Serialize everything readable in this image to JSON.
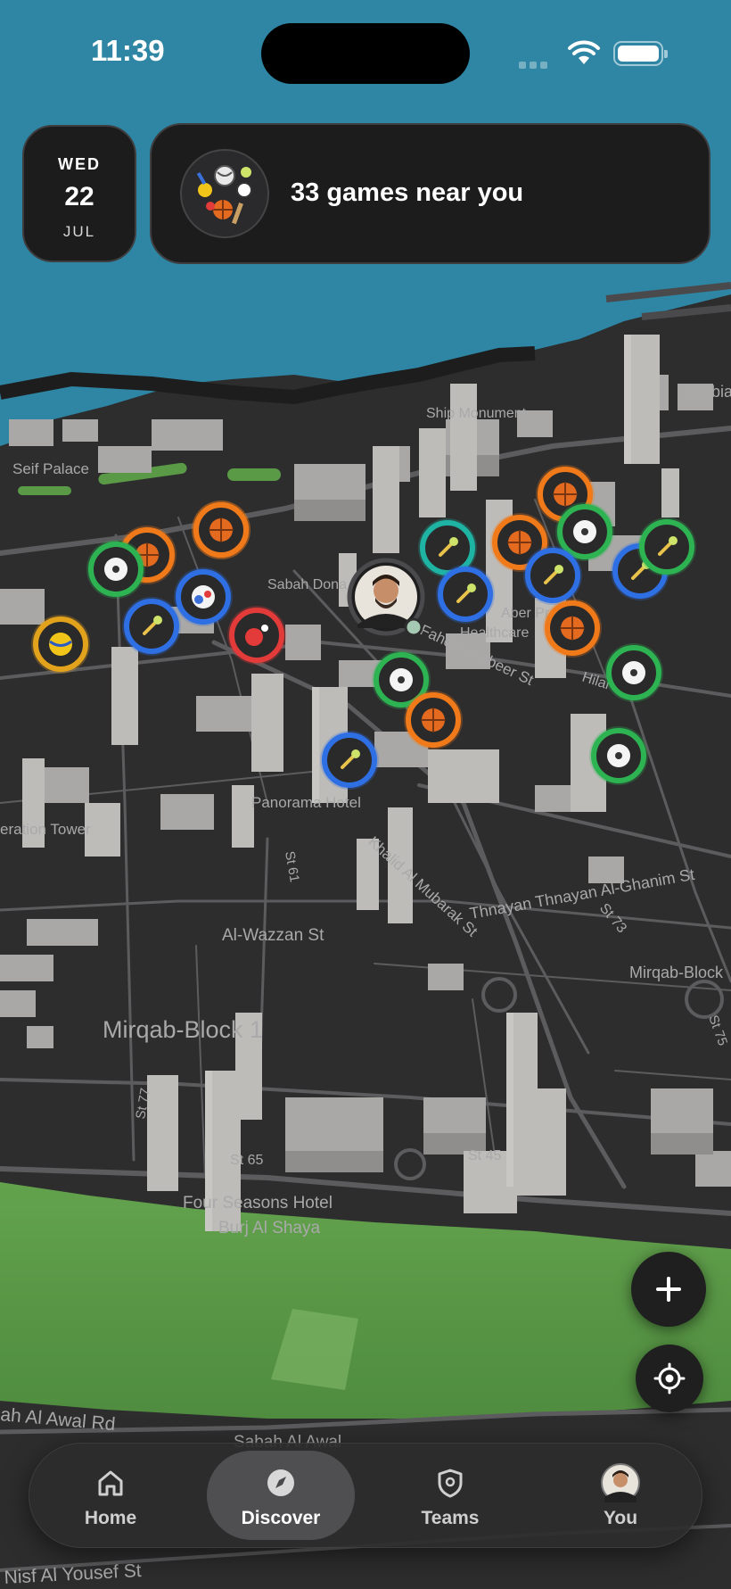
{
  "status_bar": {
    "time": "11:39"
  },
  "date_card": {
    "weekday": "WED",
    "day": "22",
    "month": "JUL"
  },
  "games_card": {
    "title": "33 games near you",
    "icon": "sports-collage-icon"
  },
  "map": {
    "labels": [
      {
        "text": "Seif Palace"
      },
      {
        "text": "Ship Monument"
      },
      {
        "text": "Arabia"
      },
      {
        "text": "Sabah Dona"
      },
      {
        "text": "Aber Pr"
      },
      {
        "text": "Healthcare"
      },
      {
        "text": "Fahd Al Kabeer St"
      },
      {
        "text": "Hilal St"
      },
      {
        "text": "Panorama Hotel"
      },
      {
        "text": "eration Tower"
      },
      {
        "text": "Al-Wazzan St"
      },
      {
        "text": "St 61"
      },
      {
        "text": "Khalid Al Mubarak St"
      },
      {
        "text": "Thnayan Thnayan Al-Ghanim St"
      },
      {
        "text": "St 73"
      },
      {
        "text": "Mirqab-Block"
      },
      {
        "text": "Mirqab-Block 1"
      },
      {
        "text": "St 77"
      },
      {
        "text": "St 65"
      },
      {
        "text": "St 45"
      },
      {
        "text": "Four Seasons Hotel"
      },
      {
        "text": "Burj Al Shaya"
      },
      {
        "text": "ah Al Awal Rd"
      },
      {
        "text": "Sabah Al Awal"
      },
      {
        "text": "Nisf Al Yousef St"
      },
      {
        "text": "St 75"
      }
    ],
    "pins": [
      {
        "sport": "basketball",
        "ring": "#f07a1a"
      },
      {
        "sport": "volleyball",
        "ring": "#e3a21c"
      },
      {
        "sport": "soccer",
        "ring": "#2db352"
      },
      {
        "sport": "tennis",
        "ring": "#2f6fe4"
      },
      {
        "sport": "table-tennis",
        "ring": "#e33a3a"
      },
      {
        "sport": "multi-sport",
        "ring": "#2f6fe4"
      },
      {
        "sport": "basketball",
        "ring": "#f07a1a"
      },
      {
        "sport": "basketball",
        "ring": "#f07a1a"
      },
      {
        "sport": "tennis",
        "ring": "#1fb3a3"
      },
      {
        "sport": "tennis",
        "ring": "#2f6fe4"
      },
      {
        "sport": "basketball",
        "ring": "#f07a1a"
      },
      {
        "sport": "basketball",
        "ring": "#f07a1a"
      },
      {
        "sport": "soccer",
        "ring": "#2db352"
      },
      {
        "sport": "tennis",
        "ring": "#2f6fe4"
      },
      {
        "sport": "tennis",
        "ring": "#2f6fe4"
      },
      {
        "sport": "tennis",
        "ring": "#2db352"
      },
      {
        "sport": "basketball",
        "ring": "#f07a1a"
      },
      {
        "sport": "soccer",
        "ring": "#2db352"
      },
      {
        "sport": "soccer",
        "ring": "#2db352"
      },
      {
        "sport": "basketball",
        "ring": "#f07a1a"
      },
      {
        "sport": "tennis",
        "ring": "#2f6fe4"
      },
      {
        "sport": "soccer",
        "ring": "#2db352"
      }
    ],
    "user_pin": {
      "icon": "user-avatar-icon"
    }
  },
  "fabs": {
    "add_icon": "plus-icon",
    "locate_icon": "crosshair-icon"
  },
  "tabbar": {
    "items": [
      {
        "label": "Home",
        "icon": "house-icon"
      },
      {
        "label": "Discover",
        "icon": "compass-icon"
      },
      {
        "label": "Teams",
        "icon": "shield-icon"
      },
      {
        "label": "You",
        "icon": "profile-avatar-icon"
      }
    ]
  },
  "colors": {
    "sea": "#2e86a4",
    "land": "#2d2d2e",
    "park": "#5a9a46",
    "card": "#1c1c1d"
  }
}
